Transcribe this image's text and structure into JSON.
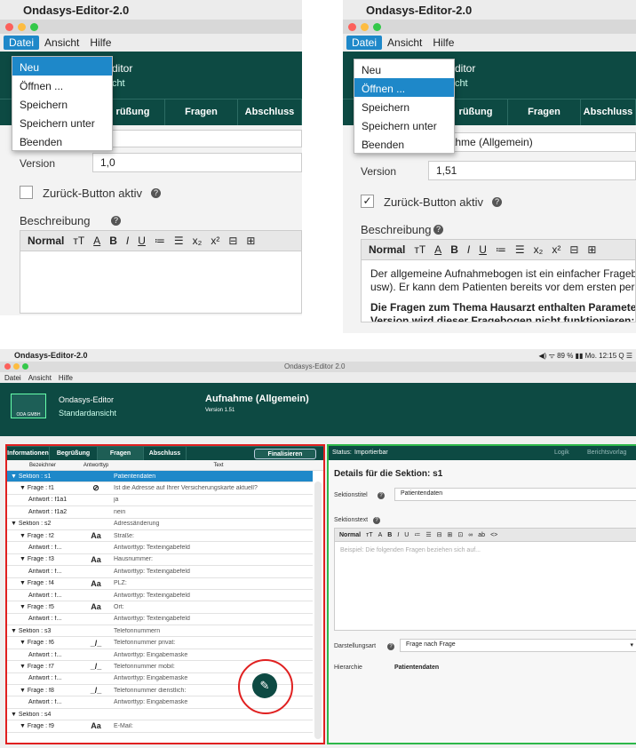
{
  "top_left": {
    "app_title": "Ondasys-Editor-2.0",
    "menu": [
      "Datei",
      "Ansicht",
      "Hilfe"
    ],
    "dropdown": [
      "Neu",
      "Öffnen ...",
      "Speichern",
      "Speichern unter ...",
      "Beenden"
    ],
    "selected_item": "Neu",
    "header_frag_1": "Editor",
    "header_frag_2": "sicht",
    "tabs": [
      "rüßung",
      "Fragen",
      "Abschluss"
    ],
    "version_label": "Version",
    "version_value": "1,0",
    "back_button_label": "Zurück-Button aktiv",
    "back_button_checked": false,
    "description_label": "Beschreibung",
    "toolbar": [
      "Normal",
      "ᴛT",
      "A",
      "B",
      "I",
      "U",
      "≔",
      "☰",
      "x₂",
      "x²",
      "⊟",
      "⊞"
    ]
  },
  "top_right": {
    "app_title": "Ondasys-Editor-2.0",
    "menu": [
      "Datei",
      "Ansicht",
      "Hilfe"
    ],
    "dropdown": [
      "Neu",
      "Öffnen ...",
      "Speichern",
      "Speichern unter ...",
      "Beenden"
    ],
    "selected_item": "Öffnen ...",
    "header_frag_1": "Editor",
    "header_frag_2": "sicht",
    "tabs": [
      "rüßung",
      "Fragen",
      "Abschluss"
    ],
    "title_frag": "nahme (Allgemein)",
    "version_label": "Version",
    "version_value": "1,51",
    "back_button_label": "Zurück-Button aktiv",
    "back_button_checked": true,
    "description_label": "Beschreibung",
    "toolbar": [
      "Normal",
      "ᴛT",
      "A",
      "B",
      "I",
      "U",
      "≔",
      "☰",
      "x₂",
      "x²",
      "⊟",
      "⊞"
    ],
    "desc_line_1": "Der allgemeine Aufnahmebogen ist ein einfacher Fragebo",
    "desc_line_2": "usw). Er kann dem Patienten bereits vor dem ersten pers",
    "desc_line_3": "Die Fragen zum Thema Hausarzt enthalten Parameter",
    "desc_line_4": "Version wird dieser Fragebogen nicht funktionieren:"
  },
  "bottom": {
    "app_title": "Ondasys-Editor-2.0",
    "window_title": "Ondasys-Editor 2.0",
    "status_right": "◀) ᯤ 89 % ▮▮ Mo. 12:15 Q ☰",
    "menu": [
      "Datei",
      "Ansicht",
      "Hilfe"
    ],
    "logo_text": "ODA GMBH",
    "app_name": "Ondasys-Editor",
    "view_name": "Standardansicht",
    "doc_title": "Aufnahme (Allgemein)",
    "doc_version": "Version 1.51",
    "tabs": [
      "Informationen",
      "Begrüßung",
      "Fragen",
      "Abschluss"
    ],
    "finalize": "Finalisieren",
    "columns": [
      "Bezeichner",
      "Antworttyp",
      "Text"
    ],
    "rows": [
      {
        "id": "▼ Sektion : s1",
        "type": "",
        "text": "Patientendaten",
        "indent": 0,
        "selected": true
      },
      {
        "id": "▼ Frage : f1",
        "type": "⊘",
        "text": "Ist die Adresse auf Ihrer Versicherungskarte aktuell?",
        "indent": 1
      },
      {
        "id": "Antwort : f1a1",
        "type": "",
        "text": "ja",
        "indent": 2
      },
      {
        "id": "Antwort : f1a2",
        "type": "",
        "text": "nein",
        "indent": 2
      },
      {
        "id": "▼ Sektion : s2",
        "type": "",
        "text": "Adressänderung",
        "indent": 0
      },
      {
        "id": "▼ Frage : f2",
        "type": "Aa",
        "text": "Straße:",
        "indent": 1
      },
      {
        "id": "Antwort : f...",
        "type": "",
        "text": "Antworttyp: Texteingabefeld",
        "indent": 2
      },
      {
        "id": "▼ Frage : f3",
        "type": "Aa",
        "text": "Hausnummer:",
        "indent": 1
      },
      {
        "id": "Antwort : f...",
        "type": "",
        "text": "Antworttyp: Texteingabefeld",
        "indent": 2
      },
      {
        "id": "▼ Frage : f4",
        "type": "Aa",
        "text": "PLZ:",
        "indent": 1
      },
      {
        "id": "Antwort : f...",
        "type": "",
        "text": "Antworttyp: Texteingabefeld",
        "indent": 2
      },
      {
        "id": "▼ Frage : f5",
        "type": "Aa",
        "text": "Ort:",
        "indent": 1
      },
      {
        "id": "Antwort : f...",
        "type": "",
        "text": "Antworttyp: Texteingabefeld",
        "indent": 2
      },
      {
        "id": "▼ Sektion : s3",
        "type": "",
        "text": "Telefonnummern",
        "indent": 0
      },
      {
        "id": "▼ Frage : f6",
        "type": "_/_",
        "text": "Telefonnummer privat:",
        "indent": 1
      },
      {
        "id": "Antwort : f...",
        "type": "",
        "text": "Antworttyp: Eingabemaske",
        "indent": 2
      },
      {
        "id": "▼ Frage : f7",
        "type": "_/_",
        "text": "Telefonnummer mobil:",
        "indent": 1
      },
      {
        "id": "Antwort : f...",
        "type": "",
        "text": "Antworttyp: Eingabemaske",
        "indent": 2
      },
      {
        "id": "▼ Frage : f8",
        "type": "_/_",
        "text": "Telefonnummer dienstlich:",
        "indent": 1
      },
      {
        "id": "Antwort : f...",
        "type": "",
        "text": "Antworttyp: Eingabemaske",
        "indent": 2
      },
      {
        "id": "▼ Sektion : s4",
        "type": "",
        "text": "",
        "indent": 0
      },
      {
        "id": "▼ Frage : f9",
        "type": "Aa",
        "text": "E-Mail:",
        "indent": 1
      }
    ],
    "status_label": "Status:",
    "status_value": "Importierbar",
    "logik": "Logik",
    "berichtsvorlage": "Berichtsvorlag",
    "details_title": "Details für die Sektion: s1",
    "section_title_label": "Sektionstitel",
    "section_title_value": "Patientendaten",
    "section_text_label": "Sektionstext",
    "editor_toolbar": [
      "Normal",
      "ᴛT",
      "A",
      "B",
      "I",
      "U",
      "≔",
      "☰",
      "⊟",
      "⊞",
      "⊡",
      "∞",
      "ab",
      "<>"
    ],
    "editor_placeholder": "Beispiel: Die folgenden Fragen beziehen sich auf...",
    "display_label": "Darstellungsart",
    "display_value": "Frage nach Frage",
    "hierarchy_label": "Hierarchie",
    "hierarchy_value": "Patientendaten",
    "colors": {
      "teal": "#0d4a43",
      "select": "#1e88c9",
      "red": "#e02020",
      "green": "#2db84a"
    }
  }
}
